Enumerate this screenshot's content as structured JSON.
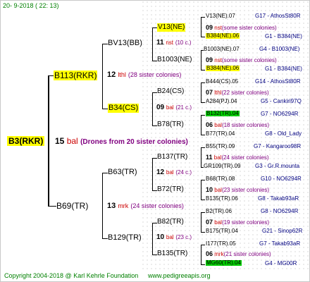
{
  "header": {
    "date_text": "20-  9-2018 (  22: 13)"
  },
  "footer": {
    "copyright": "Copyright 2004-2018 @ Karl Kehrle Foundation",
    "site": "www.pedigreeapis.org"
  },
  "root": {
    "name": "B3(RKR)",
    "count": "15",
    "breeder": "bal",
    "note": "(Drones from 20 sister colonies)"
  },
  "gen1": [
    {
      "name": "B113(RKR)",
      "count": "12",
      "breeder": "lthl",
      "note": "(28 sister colonies)"
    },
    {
      "name": "B69(TR)",
      "count": "13",
      "breeder": "mrk",
      "note": "(24 sister colonies)"
    }
  ],
  "gen2": [
    {
      "name": "BV13(BB)",
      "count": "11",
      "breeder": "nst",
      "note": "(10 c.)"
    },
    {
      "name": "B34(CS)",
      "count": "09",
      "breeder": "bal",
      "note": "(21 c.)"
    },
    {
      "name": "B63(TR)",
      "count": "12",
      "breeder": "bal",
      "note": "(24 c.)"
    },
    {
      "name": "B129(TR)",
      "count": "10",
      "breeder": "bal",
      "note": "(23 c.)"
    }
  ],
  "gen3": [
    {
      "name": "V13(NE)",
      "count": "09",
      "breeder": "nst",
      "note": "(some sister colonies)"
    },
    {
      "name": "B1003(NE)",
      "count": "09",
      "breeder": "nst",
      "note": "(some sister colonies)"
    },
    {
      "name": "B24(CS)",
      "count": "07",
      "breeder": "lthl",
      "note": "(22 sister colonies)"
    },
    {
      "name": "B78(TR)",
      "count": "06",
      "breeder": "bal",
      "note": "(18 sister colonies)"
    },
    {
      "name": "B137(TR)",
      "count": "11",
      "breeder": "bal",
      "note": "(24 sister colonies)"
    },
    {
      "name": "B72(TR)",
      "count": "10",
      "breeder": "bal",
      "note": "(23 sister colonies)"
    },
    {
      "name": "B82(TR)",
      "count": "07",
      "breeder": "bal",
      "note": "(19 sister colonies)"
    },
    {
      "name": "B135(TR)",
      "count": "06",
      "breeder": "mrk",
      "note": "(21 sister colonies)"
    }
  ],
  "gen4": [
    {
      "left": "V13(NE).07",
      "right": "G17 - AthosSt80R"
    },
    {
      "left": "B384(NE).06",
      "right": "G1 - B384(NE)"
    },
    {
      "left": "B1003(NE).07",
      "right": "G4 - B1003(NE)"
    },
    {
      "left": "B384(NE).06",
      "right": "G1 - B384(NE)"
    },
    {
      "left": "B444(CS).05",
      "right": "G14 - AthosSt80R"
    },
    {
      "left": "A284(PJ).04",
      "right": "G5 - Cankiri97Q"
    },
    {
      "left": "B132(TR).04",
      "right": "G7 - NO6294R"
    },
    {
      "left": "B77(TR).04",
      "right": "G8 - Old_Lady"
    },
    {
      "left": "B55(TR).09",
      "right": "G7 - Kangaroo98R"
    },
    {
      "left": "GR109(TR).09",
      "right": "G3 - Gr.R.mounta"
    },
    {
      "left": "B68(TR).08",
      "right": "G10 - NO6294R"
    },
    {
      "left": "B135(TR).06",
      "right": "G8 - Takab93aR"
    },
    {
      "left": "B2(TR).06",
      "right": "G8 - NO6294R"
    },
    {
      "left": "B175(TR).04",
      "right": "G21 - Sinop62R"
    },
    {
      "left": "I177(TR).05",
      "right": "G7 - Takab93aR"
    },
    {
      "left": "MG60(TR).04",
      "right": "G4 - MG00R"
    }
  ]
}
